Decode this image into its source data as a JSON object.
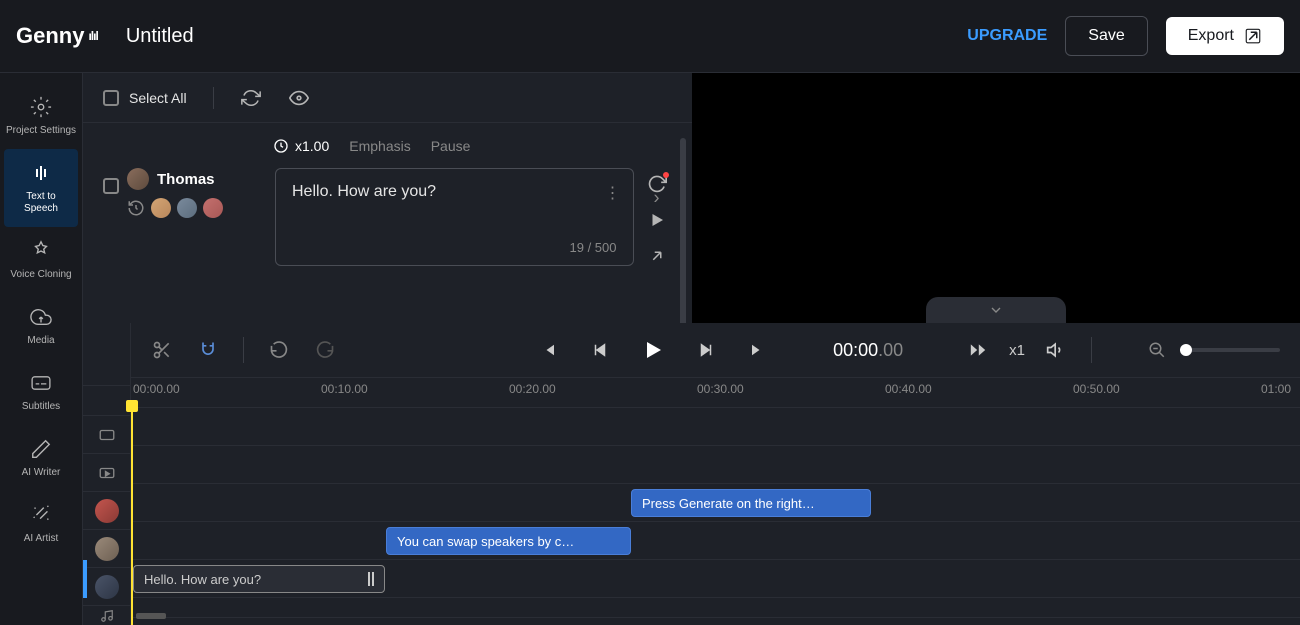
{
  "header": {
    "logo": "Genny",
    "title": "Untitled",
    "upgrade": "UPGRADE",
    "save": "Save",
    "export": "Export"
  },
  "sidebar": {
    "items": [
      {
        "label": "Project Settings"
      },
      {
        "label": "Text to Speech"
      },
      {
        "label": "Voice Cloning"
      },
      {
        "label": "Media"
      },
      {
        "label": "Subtitles"
      },
      {
        "label": "AI Writer"
      },
      {
        "label": "AI Artist"
      }
    ]
  },
  "toolbar": {
    "select_all": "Select All"
  },
  "params": {
    "speed": "x1.00",
    "emphasis": "Emphasis",
    "pause": "Pause"
  },
  "block": {
    "speaker": "Thomas",
    "text": "Hello. How are you?",
    "count": "19 / 500"
  },
  "timeline": {
    "time_main": "00:00",
    "time_ms": ".00",
    "speed": "x1",
    "ticks": [
      "00:00.00",
      "00:10.00",
      "00:20.00",
      "00:30.00",
      "00:40.00",
      "00:50.00",
      "01:00"
    ],
    "clips": {
      "c1": "Press Generate on the right…",
      "c2": "You can swap speakers by c…",
      "c3": "Hello. How are you?"
    }
  }
}
